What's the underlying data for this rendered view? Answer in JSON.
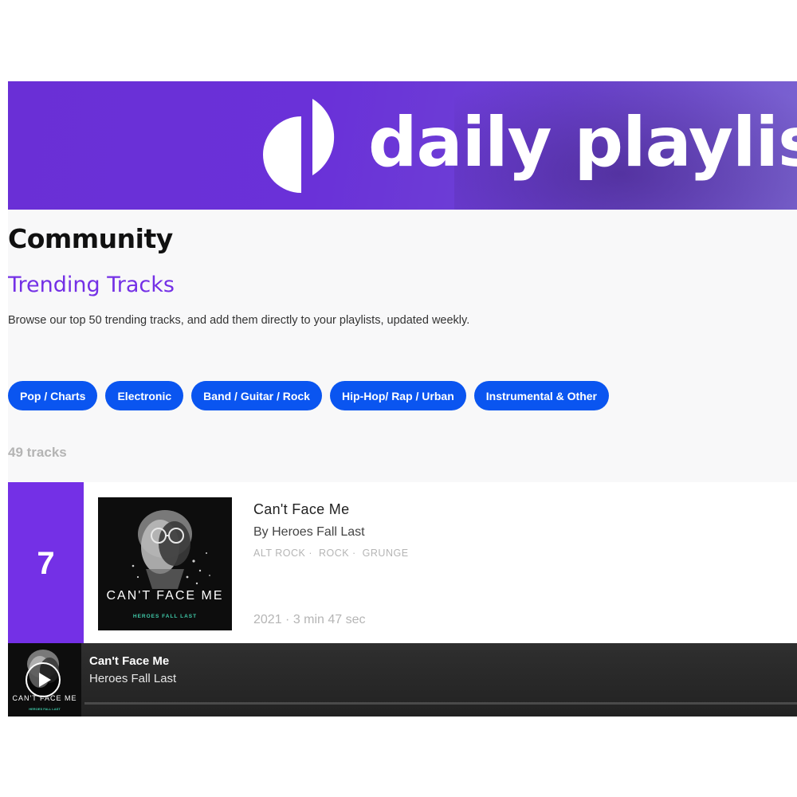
{
  "banner": {
    "wordmark": "daily playlist",
    "logo_icon": "daily-playlists-logo-icon"
  },
  "section_title": "Community",
  "page_title": "Trending Tracks",
  "description": "Browse our top 50 trending tracks, and add them directly to your playlists, updated weekly.",
  "genres": [
    {
      "label": "Pop / Charts"
    },
    {
      "label": "Electronic"
    },
    {
      "label": "Band / Guitar / Rock"
    },
    {
      "label": "Hip-Hop/ Rap / Urban"
    },
    {
      "label": "Instrumental & Other"
    }
  ],
  "track_count": "49 tracks",
  "track": {
    "rank": "7",
    "title": "Can't Face Me",
    "artist": "By Heroes Fall Last",
    "tags": [
      "ALT ROCK",
      "ROCK",
      "GRUNGE"
    ],
    "meta": "2021 · 3 min 47 sec",
    "cover_title": "CAN'T FACE ME",
    "cover_band": "HEROES FALL LAST"
  },
  "player": {
    "title": "Can't Face Me",
    "artist": "Heroes Fall Last",
    "progress": 0,
    "play_icon": "play-icon"
  },
  "colors": {
    "brand_purple": "#7430e6",
    "chip_blue": "#0a55f0",
    "player_bg": "#2a2a2a"
  }
}
